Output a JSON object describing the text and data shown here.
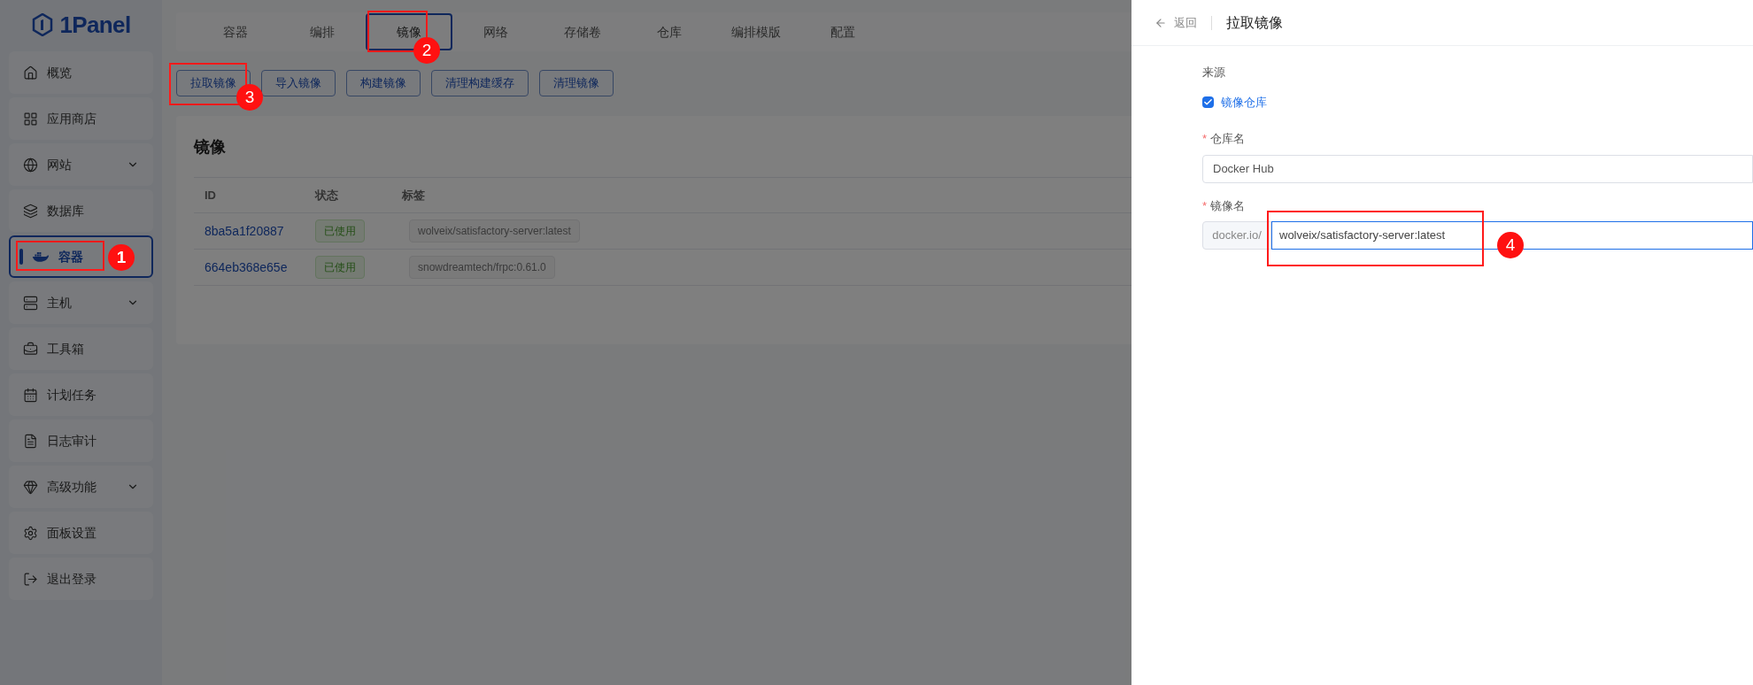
{
  "logo": {
    "text": "1Panel"
  },
  "sidebar": {
    "items": [
      {
        "label": "概览",
        "selected": false,
        "has_submenu": false
      },
      {
        "label": "应用商店",
        "selected": false,
        "has_submenu": false
      },
      {
        "label": "网站",
        "selected": false,
        "has_submenu": true
      },
      {
        "label": "数据库",
        "selected": false,
        "has_submenu": false
      },
      {
        "label": "容器",
        "selected": true,
        "has_submenu": false,
        "annotation": "1"
      },
      {
        "label": "主机",
        "selected": false,
        "has_submenu": true
      },
      {
        "label": "工具箱",
        "selected": false,
        "has_submenu": false
      },
      {
        "label": "计划任务",
        "selected": false,
        "has_submenu": false
      },
      {
        "label": "日志审计",
        "selected": false,
        "has_submenu": false
      },
      {
        "label": "高级功能",
        "selected": false,
        "has_submenu": true
      },
      {
        "label": "面板设置",
        "selected": false,
        "has_submenu": false
      },
      {
        "label": "退出登录",
        "selected": false,
        "has_submenu": false
      }
    ]
  },
  "tabs": [
    {
      "label": "容器",
      "selected": false
    },
    {
      "label": "编排",
      "selected": false
    },
    {
      "label": "镜像",
      "selected": true,
      "annotation": "2"
    },
    {
      "label": "网络",
      "selected": false
    },
    {
      "label": "存储卷",
      "selected": false
    },
    {
      "label": "仓库",
      "selected": false
    },
    {
      "label": "编排模版",
      "selected": false
    },
    {
      "label": "配置",
      "selected": false
    }
  ],
  "toolbar": [
    {
      "label": "拉取镜像",
      "annotation": "3"
    },
    {
      "label": "导入镜像"
    },
    {
      "label": "构建镜像"
    },
    {
      "label": "清理构建缓存"
    },
    {
      "label": "清理镜像"
    }
  ],
  "card": {
    "title": "镜像",
    "table": {
      "columns": [
        "ID",
        "状态",
        "标签"
      ],
      "rows": [
        {
          "id": "8ba5a1f20887",
          "status": "已使用",
          "tag": "wolveix/satisfactory-server:latest"
        },
        {
          "id": "664eb368e65e",
          "status": "已使用",
          "tag": "snowdreamtech/frpc:0.61.0"
        }
      ]
    }
  },
  "drawer": {
    "back": "返回",
    "title": "拉取镜像",
    "source_label": "来源",
    "source_option": {
      "label": "镜像仓库",
      "checked": true
    },
    "repo_label": "仓库名",
    "repo_value": "Docker Hub",
    "image_label": "镜像名",
    "image_prefix": "docker.io/",
    "image_value": "wolveix/satisfactory-server:latest",
    "image_annotation": "4",
    "required_mark": "*"
  }
}
